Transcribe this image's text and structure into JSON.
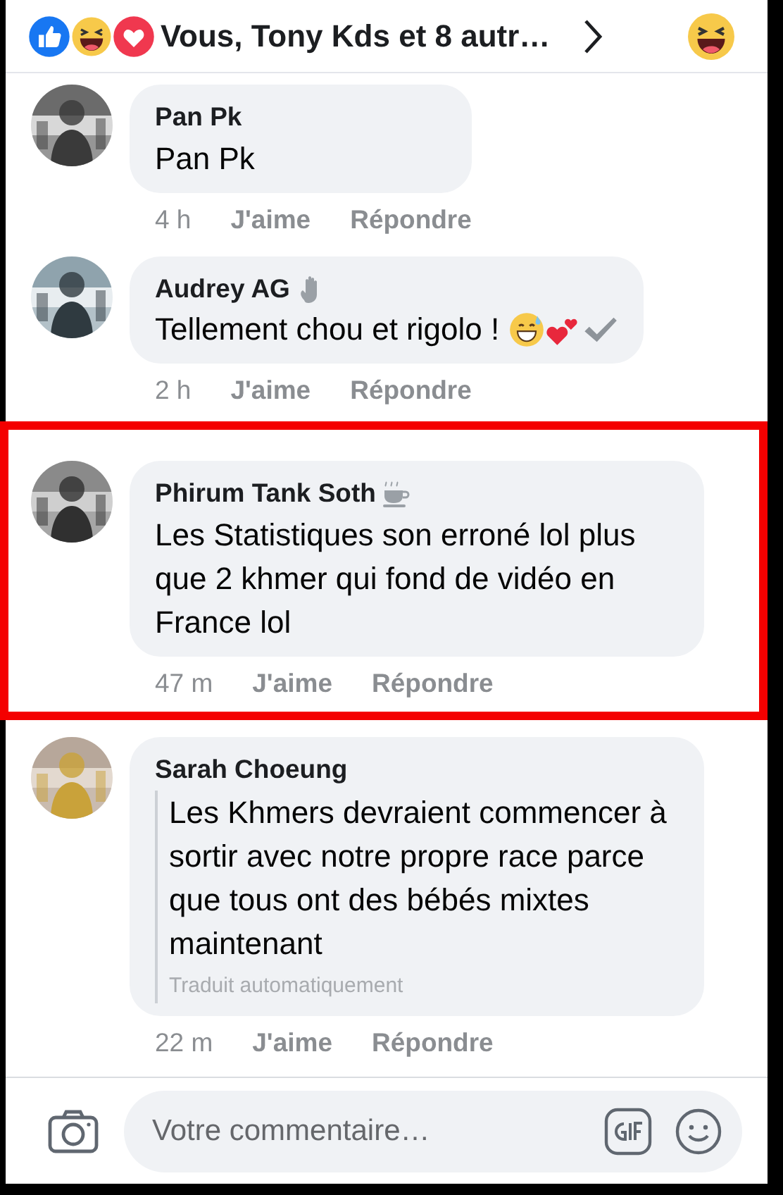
{
  "header": {
    "summary": "Vous, Tony Kds et 8 autr…"
  },
  "comments": [
    {
      "author": "Pan Pk",
      "text": "Pan Pk",
      "kind": "plain",
      "highlighted": false,
      "time": "4 h",
      "like": "J'aime",
      "reply": "Répondre"
    },
    {
      "author": "Audrey AG",
      "author_badge": {
        "kind": "wave"
      },
      "text": "Tellement chou et rigolo !",
      "kind": "emoji",
      "highlighted": false,
      "time": "2 h",
      "like": "J'aime",
      "reply": "Répondre"
    },
    {
      "author": "Phirum Tank Soth",
      "author_badge": {
        "kind": "cup"
      },
      "text": "Les Statistiques son erroné lol plus que 2 khmer qui fond de vidéo en France lol",
      "kind": "plain",
      "highlighted": true,
      "time": "47 m",
      "like": "J'aime",
      "reply": "Répondre"
    },
    {
      "author": "Sarah Choeung",
      "text": "Les Khmers devraient commencer à sortir avec notre propre race parce que tous ont des bébés mixtes maintenant",
      "kind": "translated",
      "note": "Traduit automatiquement",
      "highlighted": false,
      "time": "22 m",
      "like": "J'aime",
      "reply": "Répondre"
    }
  ],
  "composer": {
    "placeholder": "Votre commentaire…"
  }
}
